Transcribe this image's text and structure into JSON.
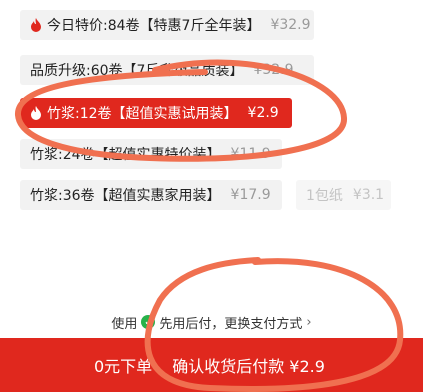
{
  "options": [
    {
      "label": "今日特价:84卷【特惠7斤全年装】",
      "price": "¥32.9",
      "hot": true
    },
    {
      "label": "品质升级:60卷【7斤升级品质装】",
      "price": "¥32.9"
    },
    {
      "label": "竹浆:12卷【超值实惠试用装】",
      "price": "¥2.9",
      "hot": true,
      "selected": true
    },
    {
      "label": "竹浆:24卷【超值实惠特价装】",
      "price": "¥11.9"
    },
    {
      "label": "竹浆:36卷【超值实惠家用装】",
      "price": "¥17.9"
    },
    {
      "label": "1包纸",
      "price": "¥3.1",
      "disabled": true
    }
  ],
  "payment_tip": {
    "prefix": "使用",
    "badge": "✓",
    "text": "先用后付，更换支付方式",
    "chevron": "›"
  },
  "bottom_bar": {
    "left_label": "0元下单",
    "right_label": "确认收货后付款 ¥2.9"
  },
  "colors": {
    "accent": "#e0281e",
    "annotation": "#f07050",
    "badge": "#27b24a"
  }
}
